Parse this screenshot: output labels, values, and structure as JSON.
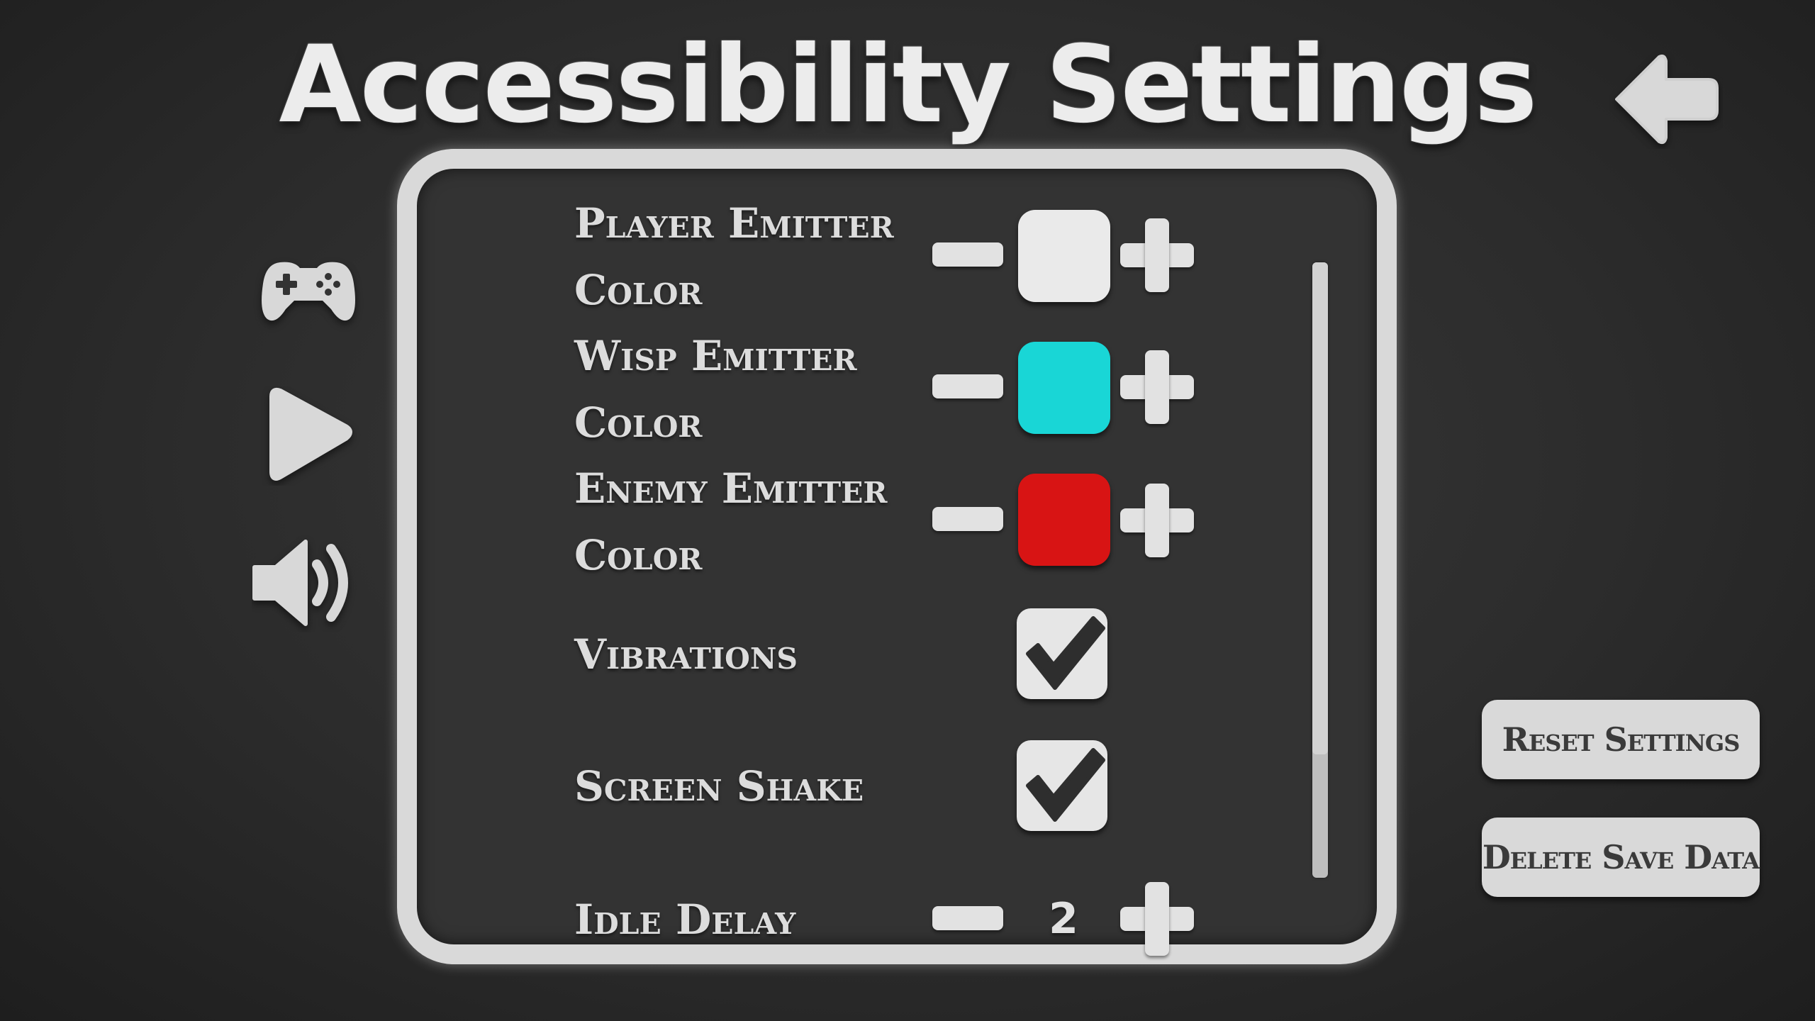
{
  "title": "Accessibility Settings",
  "icons": {
    "back": "back-arrow-icon",
    "controls": "gamepad-icon",
    "gameplay": "play-icon",
    "audio": "speaker-icon"
  },
  "settings": [
    {
      "label_line1": "Player Emitter",
      "label_line2": "Color",
      "type": "color",
      "color": "#eaeaea"
    },
    {
      "label_line1": "Wisp Emitter",
      "label_line2": "Color",
      "type": "color",
      "color": "#19d6d6"
    },
    {
      "label_line1": "Enemy Emitter",
      "label_line2": "Color",
      "type": "color",
      "color": "#d81414"
    },
    {
      "label": "Vibrations",
      "type": "checkbox",
      "checked": true
    },
    {
      "label": "Screen Shake",
      "type": "checkbox",
      "checked": true
    },
    {
      "label": "Idle Delay",
      "type": "stepper",
      "value": "2"
    }
  ],
  "scrollbar": {
    "thumb_fraction": 0.8
  },
  "buttons": {
    "reset": "Reset Settings",
    "delete": "Delete Save Data"
  }
}
